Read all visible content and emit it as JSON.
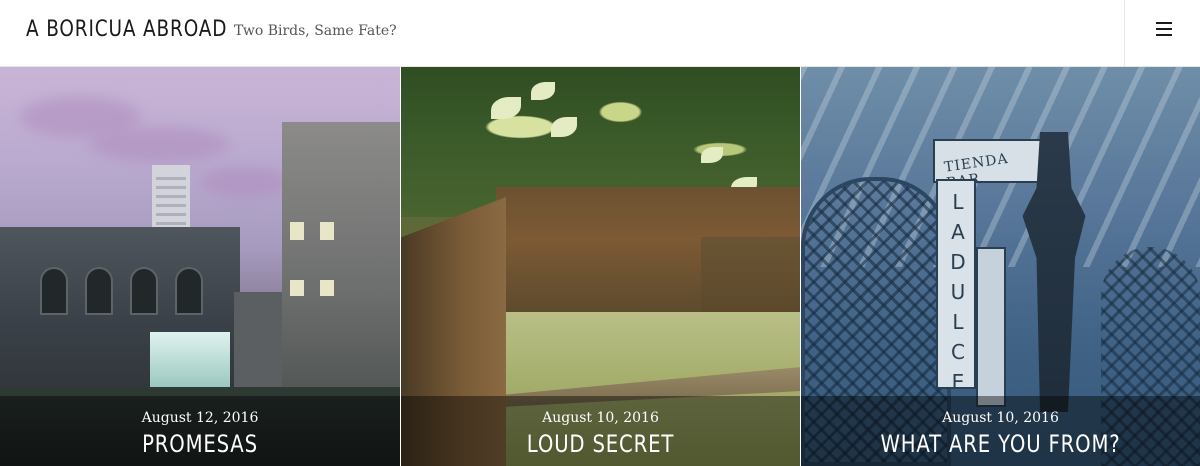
{
  "header": {
    "site_title": "A BORICUA ABROAD",
    "tagline": "Two Birds, Same Fate?",
    "menu_icon": "hamburger-menu-icon"
  },
  "posts": [
    {
      "date": "August 12, 2016",
      "title": "PROMESAS"
    },
    {
      "date": "August 10, 2016",
      "title": "LOUD SECRET"
    },
    {
      "date": "August 10, 2016",
      "title": "WHAT ARE YOU FROM?"
    }
  ],
  "photo3_sign": {
    "top": "TIENDA BAR",
    "vertical": "LA DULCE"
  },
  "colors": {
    "overlay": "rgba(0,0,0,0.42)",
    "text_on_image": "#ffffff",
    "title_text": "#1a1a1a"
  }
}
